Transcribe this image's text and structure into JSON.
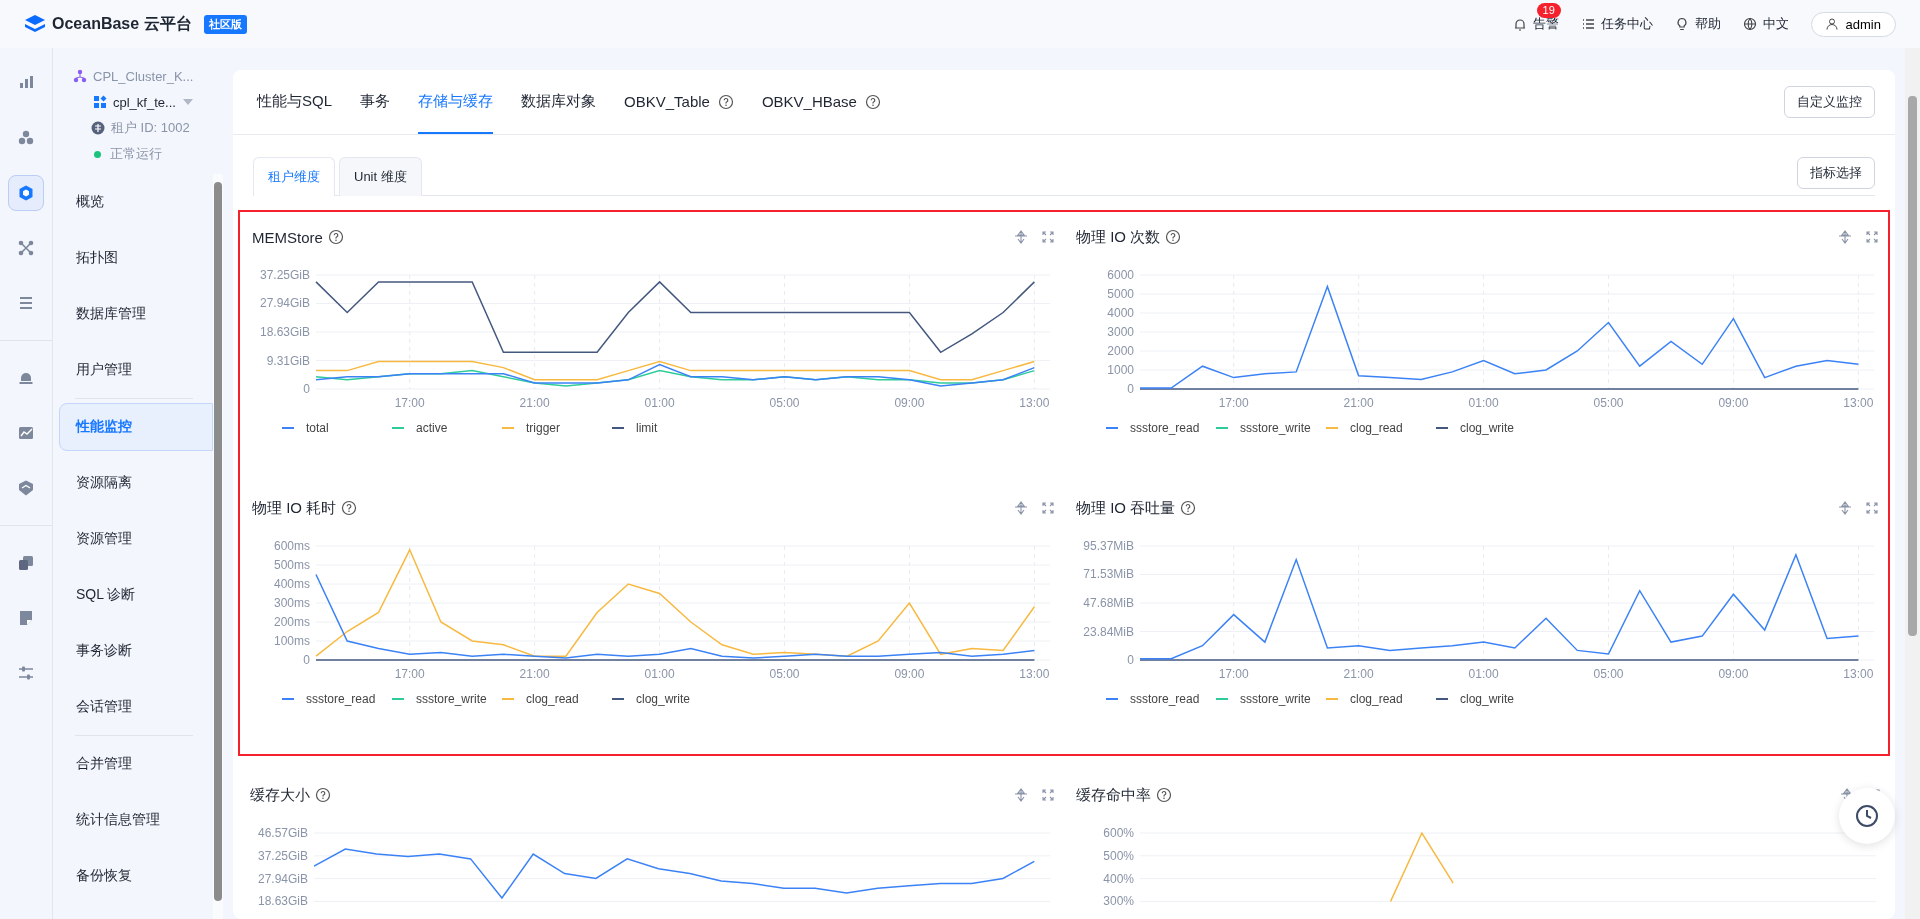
{
  "header": {
    "logo": "OceanBase 云平台",
    "edition": "社区版",
    "alerts": {
      "label": "告警",
      "count": "19"
    },
    "links": [
      {
        "kind": "tasks",
        "label": "任务中心"
      },
      {
        "kind": "help",
        "label": "帮助"
      },
      {
        "kind": "language",
        "label": "中文"
      }
    ],
    "user": "admin"
  },
  "rail": [
    {
      "kind": "bars",
      "selected": false
    },
    {
      "kind": "cluster",
      "selected": false
    },
    {
      "kind": "cube",
      "selected": true
    },
    {
      "kind": "nodes",
      "selected": false
    },
    {
      "kind": "list",
      "selected": false
    },
    {
      "kind": "alarm",
      "selected": false
    },
    {
      "kind": "trend",
      "selected": false
    },
    {
      "kind": "shield",
      "selected": false
    },
    {
      "kind": "copy",
      "selected": false
    },
    {
      "kind": "note",
      "selected": false
    },
    {
      "kind": "sliders",
      "selected": false
    }
  ],
  "tenant": {
    "cluster": "CPL_Cluster_K...",
    "name": "cpl_kf_te...",
    "id": "租户 ID: 1002",
    "status": "正常运行"
  },
  "nav_groups": [
    {
      "items": [
        {
          "label": "概览",
          "selected": false
        },
        {
          "label": "拓扑图",
          "selected": false
        },
        {
          "label": "数据库管理",
          "selected": false
        },
        {
          "label": "用户管理",
          "selected": false
        }
      ]
    },
    {
      "items": [
        {
          "label": "性能监控",
          "selected": true
        },
        {
          "label": "资源隔离",
          "selected": false
        },
        {
          "label": "资源管理",
          "selected": false
        },
        {
          "label": "SQL 诊断",
          "selected": false
        },
        {
          "label": "事务诊断",
          "selected": false
        },
        {
          "label": "会话管理",
          "selected": false
        }
      ]
    },
    {
      "items": [
        {
          "label": "合并管理",
          "selected": false
        },
        {
          "label": "统计信息管理",
          "selected": false
        },
        {
          "label": "备份恢复",
          "selected": false
        }
      ]
    }
  ],
  "tabs": [
    {
      "label": "性能与SQL",
      "selected": false,
      "help": false
    },
    {
      "label": "事务",
      "selected": false,
      "help": false
    },
    {
      "label": "存储与缓存",
      "selected": true,
      "help": false
    },
    {
      "label": "数据库对象",
      "selected": false,
      "help": false
    },
    {
      "label": "OBKV_Table",
      "selected": false,
      "help": true
    },
    {
      "label": "OBKV_HBase",
      "selected": false,
      "help": true
    }
  ],
  "tab_action": "自定义监控",
  "subtabs": [
    {
      "label": "租户维度",
      "selected": true
    },
    {
      "label": "Unit 维度",
      "selected": false
    }
  ],
  "subtab_action": "指标选择",
  "chart_groups": [
    {
      "highlighted": true,
      "charts": [
        {
          "title": "MEMStore",
          "help": true,
          "chart_data": {
            "type": "line",
            "categories": [
              null,
              null,
              null,
              "17:00",
              null,
              null,
              null,
              "21:00",
              null,
              null,
              null,
              "01:00",
              null,
              null,
              null,
              "05:00",
              null,
              null,
              null,
              "09:00",
              null,
              null,
              null,
              "13:00"
            ],
            "grid": true,
            "ylim": [
              0,
              37.25
            ],
            "yticks": [
              {
                "value": 0,
                "label": "0"
              },
              {
                "value": 9.31,
                "label": "9.31GiB"
              },
              {
                "value": 18.63,
                "label": "18.63GiB"
              },
              {
                "value": 27.94,
                "label": "27.94GiB"
              },
              {
                "value": 37.25,
                "label": "37.25GiB"
              }
            ],
            "series": [
              {
                "name": "total",
                "color": "#3b82f6",
                "values": [
                  3,
                  4,
                  4,
                  5,
                  5,
                  5,
                  5,
                  2,
                  2,
                  2,
                  3,
                  8,
                  4,
                  4,
                  3,
                  4,
                  3,
                  4,
                  4,
                  3,
                  1,
                  2,
                  3,
                  7
                ]
              },
              {
                "name": "active",
                "color": "#2ecc9a",
                "values": [
                  4,
                  3,
                  4,
                  5,
                  5,
                  6,
                  4,
                  2,
                  1,
                  2,
                  3,
                  6,
                  4,
                  3,
                  3,
                  4,
                  3,
                  4,
                  3,
                  3,
                  2,
                  2,
                  3,
                  6
                ]
              },
              {
                "name": "trigger",
                "color": "#f7b940",
                "values": [
                  6,
                  6,
                  9,
                  9,
                  9,
                  9,
                  7,
                  3,
                  3,
                  3,
                  6,
                  9,
                  6,
                  6,
                  6,
                  6,
                  6,
                  6,
                  6,
                  6,
                  3,
                  3,
                  6,
                  9
                ]
              },
              {
                "name": "limit",
                "color": "#44587f",
                "values": [
                  35,
                  25,
                  35,
                  35,
                  35,
                  35,
                  12,
                  12,
                  12,
                  12,
                  25,
                  35,
                  25,
                  25,
                  25,
                  25,
                  25,
                  25,
                  25,
                  25,
                  12,
                  18,
                  25,
                  35
                ]
              }
            ]
          }
        },
        {
          "title": "物理 IO 次数",
          "help": true,
          "chart_data": {
            "type": "line",
            "categories": [
              null,
              null,
              null,
              "17:00",
              null,
              null,
              null,
              "21:00",
              null,
              null,
              null,
              "01:00",
              null,
              null,
              null,
              "05:00",
              null,
              null,
              null,
              "09:00",
              null,
              null,
              null,
              "13:00"
            ],
            "grid": true,
            "ylim": [
              0,
              6000
            ],
            "yticks": [
              {
                "value": 0,
                "label": "0"
              },
              {
                "value": 1000,
                "label": "1000"
              },
              {
                "value": 2000,
                "label": "2000"
              },
              {
                "value": 3000,
                "label": "3000"
              },
              {
                "value": 4000,
                "label": "4000"
              },
              {
                "value": 5000,
                "label": "5000"
              },
              {
                "value": 6000,
                "label": "6000"
              }
            ],
            "series": [
              {
                "name": "ssstore_read",
                "color": "#3b82f6",
                "values": [
                  50,
                  50,
                  1200,
                  600,
                  800,
                  900,
                  5400,
                  700,
                  600,
                  500,
                  900,
                  1500,
                  800,
                  1000,
                  2000,
                  3500,
                  1200,
                  2500,
                  1300,
                  3700,
                  600,
                  1200,
                  1500,
                  1300
                ]
              },
              {
                "name": "ssstore_write",
                "color": "#2ecc9a",
                "values": [
                  null,
                  null,
                  null,
                  null,
                  null,
                  null,
                  null,
                  null,
                  null,
                  null,
                  null,
                  null,
                  null,
                  null,
                  null,
                  null,
                  null,
                  null,
                  null,
                  null,
                  null,
                  null,
                  null,
                  null
                ]
              },
              {
                "name": "clog_read",
                "color": "#f7b940",
                "values": [
                  null,
                  null,
                  null,
                  null,
                  null,
                  null,
                  null,
                  null,
                  null,
                  null,
                  null,
                  null,
                  null,
                  null,
                  null,
                  null,
                  null,
                  null,
                  null,
                  null,
                  null,
                  null,
                  null,
                  null
                ]
              },
              {
                "name": "clog_write",
                "color": "#44587f",
                "values": [
                  0,
                  0,
                  0,
                  0,
                  0,
                  0,
                  0,
                  0,
                  0,
                  0,
                  0,
                  0,
                  0,
                  0,
                  0,
                  0,
                  0,
                  0,
                  0,
                  0,
                  0,
                  0,
                  0,
                  0
                ]
              }
            ]
          }
        },
        {
          "title": "物理 IO 耗时",
          "help": true,
          "chart_data": {
            "type": "line",
            "categories": [
              null,
              null,
              null,
              "17:00",
              null,
              null,
              null,
              "21:00",
              null,
              null,
              null,
              "01:00",
              null,
              null,
              null,
              "05:00",
              null,
              null,
              null,
              "09:00",
              null,
              null,
              null,
              "13:00"
            ],
            "grid": true,
            "ylim": [
              0,
              600
            ],
            "yticks": [
              {
                "value": 0,
                "label": "0"
              },
              {
                "value": 100,
                "label": "100ms"
              },
              {
                "value": 200,
                "label": "200ms"
              },
              {
                "value": 300,
                "label": "300ms"
              },
              {
                "value": 400,
                "label": "400ms"
              },
              {
                "value": 500,
                "label": "500ms"
              },
              {
                "value": 600,
                "label": "600ms"
              }
            ],
            "series": [
              {
                "name": "ssstore_read",
                "color": "#3b82f6",
                "values": [
                  450,
                  100,
                  60,
                  30,
                  40,
                  20,
                  30,
                  20,
                  10,
                  30,
                  20,
                  30,
                  60,
                  20,
                  10,
                  20,
                  30,
                  20,
                  20,
                  30,
                  40,
                  20,
                  30,
                  50
                ]
              },
              {
                "name": "ssstore_write",
                "color": "#2ecc9a",
                "values": [
                  null,
                  null,
                  null,
                  null,
                  null,
                  null,
                  null,
                  null,
                  null,
                  null,
                  null,
                  null,
                  null,
                  null,
                  null,
                  null,
                  null,
                  null,
                  null,
                  null,
                  null,
                  null,
                  null,
                  null
                ]
              },
              {
                "name": "clog_read",
                "color": "#f7b940",
                "values": [
                  20,
                  150,
                  250,
                  580,
                  200,
                  100,
                  80,
                  20,
                  20,
                  250,
                  400,
                  350,
                  200,
                  80,
                  30,
                  40,
                  30,
                  20,
                  100,
                  300,
                  30,
                  60,
                  50,
                  280
                ]
              },
              {
                "name": "clog_write",
                "color": "#44587f",
                "values": [
                  0,
                  0,
                  0,
                  0,
                  0,
                  0,
                  0,
                  0,
                  0,
                  0,
                  0,
                  0,
                  0,
                  0,
                  0,
                  0,
                  0,
                  0,
                  0,
                  0,
                  0,
                  0,
                  0,
                  0
                ]
              }
            ]
          }
        },
        {
          "title": "物理 IO 吞吐量",
          "help": true,
          "chart_data": {
            "type": "line",
            "categories": [
              null,
              null,
              null,
              "17:00",
              null,
              null,
              null,
              "21:00",
              null,
              null,
              null,
              "01:00",
              null,
              null,
              null,
              "05:00",
              null,
              null,
              null,
              "09:00",
              null,
              null,
              null,
              "13:00"
            ],
            "grid": true,
            "ylim": [
              0,
              95.37
            ],
            "yticks": [
              {
                "value": 0,
                "label": "0"
              },
              {
                "value": 23.84,
                "label": "23.84MiB"
              },
              {
                "value": 47.68,
                "label": "47.68MiB"
              },
              {
                "value": 71.53,
                "label": "71.53MiB"
              },
              {
                "value": 95.37,
                "label": "95.37MiB"
              }
            ],
            "series": [
              {
                "name": "ssstore_read",
                "color": "#3b82f6",
                "values": [
                  1,
                  1,
                  12,
                  38,
                  15,
                  84,
                  10,
                  12,
                  8,
                  10,
                  12,
                  15,
                  10,
                  35,
                  8,
                  5,
                  58,
                  15,
                  20,
                  55,
                  25,
                  88,
                  18,
                  20
                ]
              },
              {
                "name": "ssstore_write",
                "color": "#2ecc9a",
                "values": [
                  null,
                  null,
                  null,
                  null,
                  null,
                  null,
                  null,
                  null,
                  null,
                  null,
                  null,
                  null,
                  null,
                  null,
                  null,
                  null,
                  null,
                  null,
                  null,
                  null,
                  null,
                  null,
                  null,
                  null
                ]
              },
              {
                "name": "clog_read",
                "color": "#f7b940",
                "values": [
                  null,
                  null,
                  null,
                  null,
                  null,
                  null,
                  null,
                  null,
                  null,
                  null,
                  null,
                  null,
                  null,
                  null,
                  null,
                  null,
                  null,
                  null,
                  null,
                  null,
                  null,
                  null,
                  null,
                  null
                ]
              },
              {
                "name": "clog_write",
                "color": "#44587f",
                "values": [
                  0,
                  0,
                  0,
                  0,
                  0,
                  0,
                  0,
                  0,
                  0,
                  0,
                  0,
                  0,
                  0,
                  0,
                  0,
                  0,
                  0,
                  0,
                  0,
                  0,
                  0,
                  0,
                  0,
                  0
                ]
              }
            ]
          }
        }
      ]
    },
    {
      "highlighted": false,
      "charts": [
        {
          "title": "缓存大小",
          "help": true,
          "chart_data": {
            "type": "line",
            "categories": [
              null,
              null,
              null,
              null,
              null,
              null,
              null,
              null,
              null,
              null,
              null,
              null,
              null,
              null,
              null,
              null,
              null,
              null,
              null,
              null,
              null,
              null,
              null,
              null
            ],
            "grid": true,
            "ylim": [
              18.63,
              46.57
            ],
            "yticks": [
              {
                "value": 18.63,
                "label": "18.63GiB"
              },
              {
                "value": 27.94,
                "label": "27.94GiB"
              },
              {
                "value": 37.25,
                "label": "37.25GiB"
              },
              {
                "value": 46.57,
                "label": "46.57GiB"
              }
            ],
            "series": [
              {
                "color": "#3b82f6",
                "values": [
                  33,
                  40,
                  38,
                  37,
                  38,
                  36,
                  20,
                  38,
                  30,
                  28,
                  36,
                  32,
                  30,
                  27,
                  26,
                  24,
                  24,
                  22,
                  24,
                  25,
                  26,
                  26,
                  28,
                  35
                ]
              }
            ]
          }
        },
        {
          "title": "缓存命中率",
          "help": true,
          "chart_data": {
            "type": "line",
            "categories": [
              null,
              null,
              null,
              null,
              null,
              null,
              null,
              null,
              null,
              null,
              null,
              null,
              null,
              null,
              null,
              null,
              null,
              null,
              null,
              null,
              null,
              null,
              null,
              null
            ],
            "grid": true,
            "ylim": [
              300,
              600
            ],
            "yticks": [
              {
                "value": 300,
                "label": "300%"
              },
              {
                "value": 400,
                "label": "400%"
              },
              {
                "value": 500,
                "label": "500%"
              },
              {
                "value": 600,
                "label": "600%"
              }
            ],
            "series": [
              {
                "color": "#f7b940",
                "values": [
                  null,
                  null,
                  null,
                  null,
                  null,
                  null,
                  null,
                  null,
                  300,
                  600,
                  380,
                  null,
                  null,
                  null,
                  null,
                  null,
                  null,
                  null,
                  null,
                  null,
                  null,
                  null,
                  null,
                  null
                ]
              }
            ]
          }
        }
      ]
    }
  ]
}
